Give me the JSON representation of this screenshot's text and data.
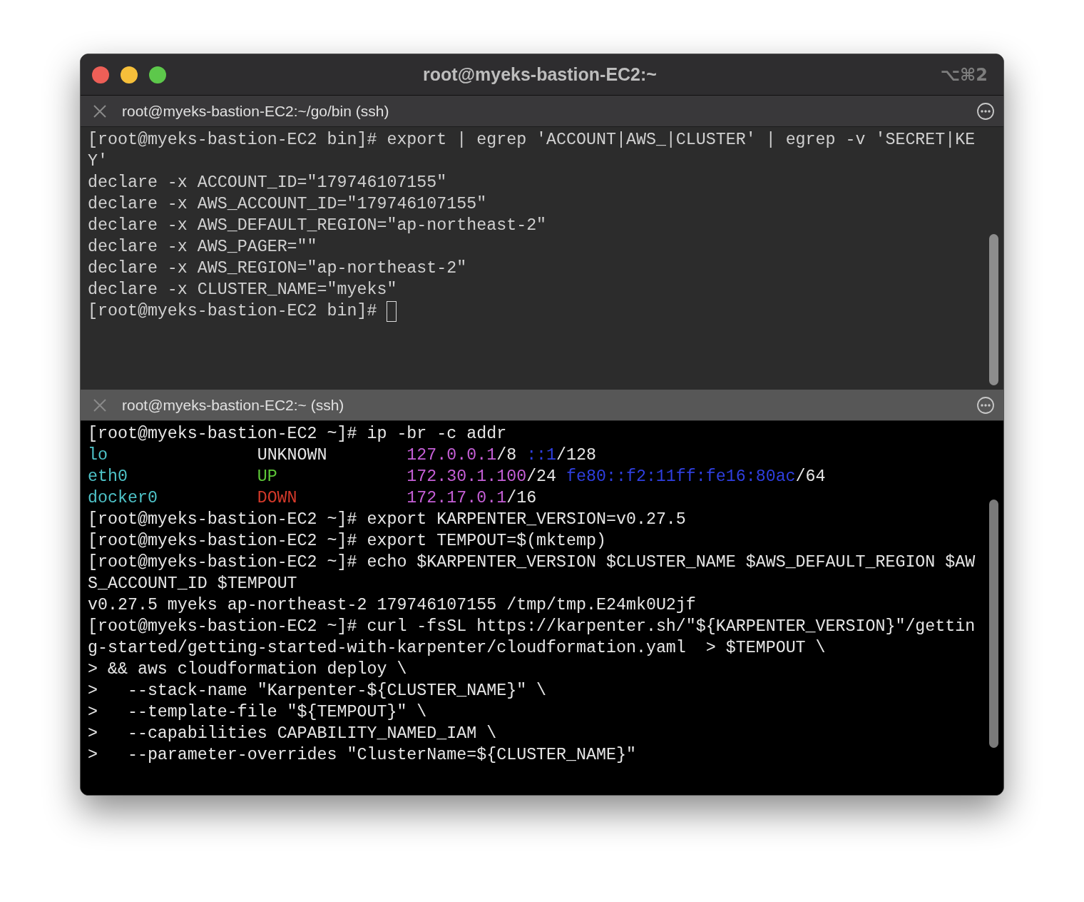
{
  "window": {
    "title": "root@myeks-bastion-EC2:~",
    "shortcut": "⌥⌘2"
  },
  "panes": [
    {
      "title": "root@myeks-bastion-EC2:~/go/bin (ssh)",
      "active": false,
      "lines": [
        {
          "kind": "text",
          "text": "[root@myeks-bastion-EC2 bin]# export | egrep 'ACCOUNT|AWS_|CLUSTER' | egrep -v 'SECRET|KE"
        },
        {
          "kind": "text",
          "text": "Y'"
        },
        {
          "kind": "text",
          "text": "declare -x ACCOUNT_ID=\"179746107155\""
        },
        {
          "kind": "text",
          "text": "declare -x AWS_ACCOUNT_ID=\"179746107155\""
        },
        {
          "kind": "text",
          "text": "declare -x AWS_DEFAULT_REGION=\"ap-northeast-2\""
        },
        {
          "kind": "text",
          "text": "declare -x AWS_PAGER=\"\""
        },
        {
          "kind": "text",
          "text": "declare -x AWS_REGION=\"ap-northeast-2\""
        },
        {
          "kind": "text",
          "text": "declare -x CLUSTER_NAME=\"myeks\""
        },
        {
          "kind": "text",
          "text": "[root@myeks-bastion-EC2 bin]#",
          "cursor": true
        }
      ]
    },
    {
      "title": "root@myeks-bastion-EC2:~ (ssh)",
      "active": true,
      "lines": [
        {
          "kind": "text",
          "text": "[root@myeks-bastion-EC2 ~]# ip -br -c addr"
        },
        {
          "kind": "ip",
          "iface": "lo",
          "state": "UNKNOWN",
          "color": "#e6e6e6",
          "addresses": [
            {
              "ip": "127.0.0.1",
              "prefix": "/8",
              "color": "#c55fd6"
            },
            {
              "ip": "::1",
              "prefix": "/128",
              "color": "#2f3fe0"
            }
          ]
        },
        {
          "kind": "ip",
          "iface": "eth0",
          "state": "UP",
          "color": "#5dc738",
          "addresses": [
            {
              "ip": "172.30.1.100",
              "prefix": "/24",
              "color": "#c55fd6"
            },
            {
              "ip": "fe80::f2:11ff:fe16:80ac",
              "prefix": "/64",
              "color": "#2f3fe0"
            }
          ]
        },
        {
          "kind": "ip",
          "iface": "docker0",
          "state": "DOWN",
          "color": "#d4392a",
          "addresses": [
            {
              "ip": "172.17.0.1",
              "prefix": "/16",
              "color": "#c55fd6"
            }
          ]
        },
        {
          "kind": "text",
          "text": "[root@myeks-bastion-EC2 ~]# export KARPENTER_VERSION=v0.27.5"
        },
        {
          "kind": "text",
          "text": "[root@myeks-bastion-EC2 ~]# export TEMPOUT=$(mktemp)"
        },
        {
          "kind": "text",
          "text": "[root@myeks-bastion-EC2 ~]# echo $KARPENTER_VERSION $CLUSTER_NAME $AWS_DEFAULT_REGION $AW"
        },
        {
          "kind": "text",
          "text": "S_ACCOUNT_ID $TEMPOUT"
        },
        {
          "kind": "text",
          "text": "v0.27.5 myeks ap-northeast-2 179746107155 /tmp/tmp.E24mk0U2jf"
        },
        {
          "kind": "text",
          "text": "[root@myeks-bastion-EC2 ~]# curl -fsSL https://karpenter.sh/\"${KARPENTER_VERSION}\"/gettin"
        },
        {
          "kind": "text",
          "text": "g-started/getting-started-with-karpenter/cloudformation.yaml  > $TEMPOUT \\"
        },
        {
          "kind": "text",
          "text": "> && aws cloudformation deploy \\"
        },
        {
          "kind": "text",
          "text": ">   --stack-name \"Karpenter-${CLUSTER_NAME}\" \\"
        },
        {
          "kind": "text",
          "text": ">   --template-file \"${TEMPOUT}\" \\"
        },
        {
          "kind": "text",
          "text": ">   --capabilities CAPABILITY_NAMED_IAM \\"
        },
        {
          "kind": "text",
          "text": ">   --parameter-overrides \"ClusterName=${CLUSTER_NAME}\""
        }
      ]
    }
  ]
}
